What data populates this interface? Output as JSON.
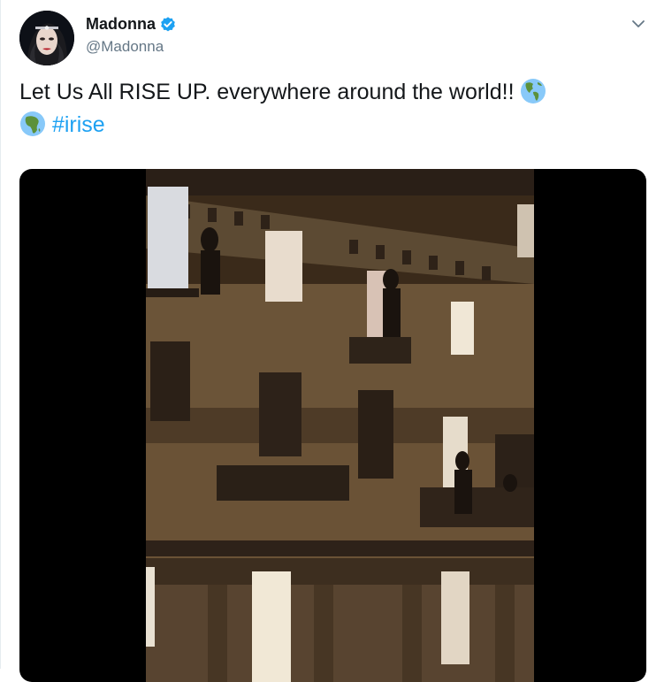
{
  "tweet": {
    "display_name": "Madonna",
    "handle": "@Madonna",
    "text_before": "Let Us All RISE UP. everywhere around the world!! ",
    "hashtag": "#irise"
  },
  "icons": {
    "avatar": "profile-photo",
    "verified": "verified-badge-icon",
    "menu": "chevron-down-icon",
    "emoji": "globe-americas-emoji"
  },
  "colors": {
    "text": "#14171a",
    "secondary": "#657786",
    "link": "#1da1f2",
    "verified": "#1da1f2"
  }
}
